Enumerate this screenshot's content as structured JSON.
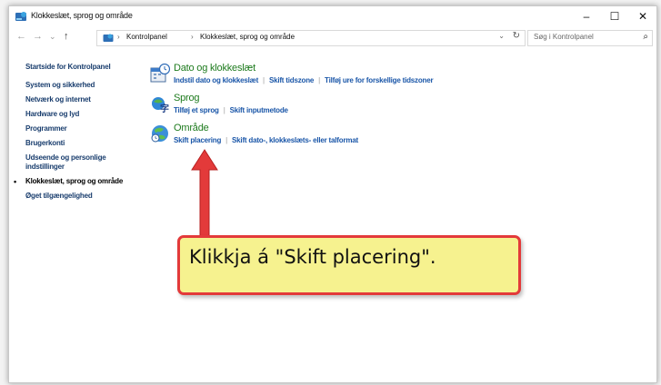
{
  "window": {
    "title": "Klokkeslæt, sprog og område",
    "controls": {
      "minimize": "–",
      "maximize": "☐",
      "close": "✕"
    }
  },
  "address": {
    "nav": {
      "back": "←",
      "forward": "→",
      "dropdown": "⌄",
      "up": "↑"
    },
    "breadcrumbs": [
      "Kontrolpanel",
      "Klokkeslæt, sprog og område"
    ],
    "separator": "›",
    "search_placeholder": "Søg i Kontrolpanel"
  },
  "sidebar": {
    "items": [
      {
        "label": "Startside for Kontrolpanel"
      },
      {
        "label": "System og sikkerhed"
      },
      {
        "label": "Netværk og internet"
      },
      {
        "label": "Hardware og lyd"
      },
      {
        "label": "Programmer"
      },
      {
        "label": "Brugerkonti"
      },
      {
        "label": "Udseende og personlige"
      },
      {
        "label": "indstillinger"
      },
      {
        "label": "Klokkeslæt, sprog og område"
      },
      {
        "label": "Øget tilgængelighed"
      }
    ],
    "current_bullet": "•"
  },
  "categories": [
    {
      "title": "Dato og klokkeslæt",
      "links": [
        "Indstil dato og klokkeslæt",
        "Skift tidszone",
        "Tilføj ure for forskellige tidszoner"
      ]
    },
    {
      "title": "Sprog",
      "links": [
        "Tilføj et sprog",
        "Skift inputmetode"
      ]
    },
    {
      "title": "Område",
      "links": [
        "Skift placering",
        "Skift dato-, klokkeslæts- eller talformat"
      ]
    }
  ],
  "link_separator": "|",
  "callout": {
    "text": "Klikkja á \"Skift placering\"."
  },
  "colors": {
    "category_title": "#1e7b1e",
    "link": "#1a56a8",
    "callout_fill": "#f6f28f",
    "callout_border": "#e33a3a",
    "arrow": "#e33a3a"
  }
}
